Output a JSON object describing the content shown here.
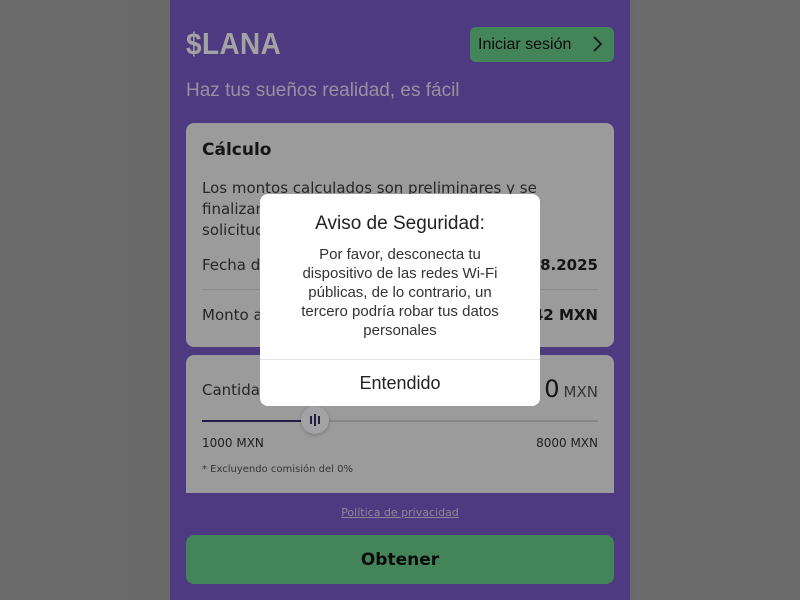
{
  "header": {
    "logo": "$LANA",
    "login_label": "Iniciar sesión",
    "tagline": "Haz tus sueños realidad, es fácil"
  },
  "calc_card": {
    "title": "Cálculo",
    "description": "Los montos calculados son preliminares y se finalizan al momento de la aprobación de la solicitud de préstamo.",
    "date_label": "Fecha de vencimiento",
    "date_value": "08.2025",
    "amount_label": "Monto a pagar",
    "amount_value": "42 MXN"
  },
  "amount_card": {
    "label": "Cantidad",
    "value": "0",
    "currency": "MXN",
    "slider_min": "1000 MXN",
    "slider_max": "8000 MXN",
    "commission_note": "* Excluyendo comisión del 0%"
  },
  "footer": {
    "privacy_link": "Política de privacidad",
    "obtain_label": "Obtener"
  },
  "modal": {
    "title": "Aviso de Seguridad:",
    "body": "Por favor, desconecta tu dispositivo de las redes Wi-Fi públicas, de lo contrario, un tercero podría robar tus datos personales",
    "confirm_label": "Entendido"
  },
  "colors": {
    "brand_purple": "#7b5bc9",
    "accent_green": "#6bcf8c",
    "slider_fill": "#3a2d6c"
  },
  "icons": {
    "login_chevron": "chevron-right-icon",
    "slider_handle": "grip-lines-icon"
  }
}
